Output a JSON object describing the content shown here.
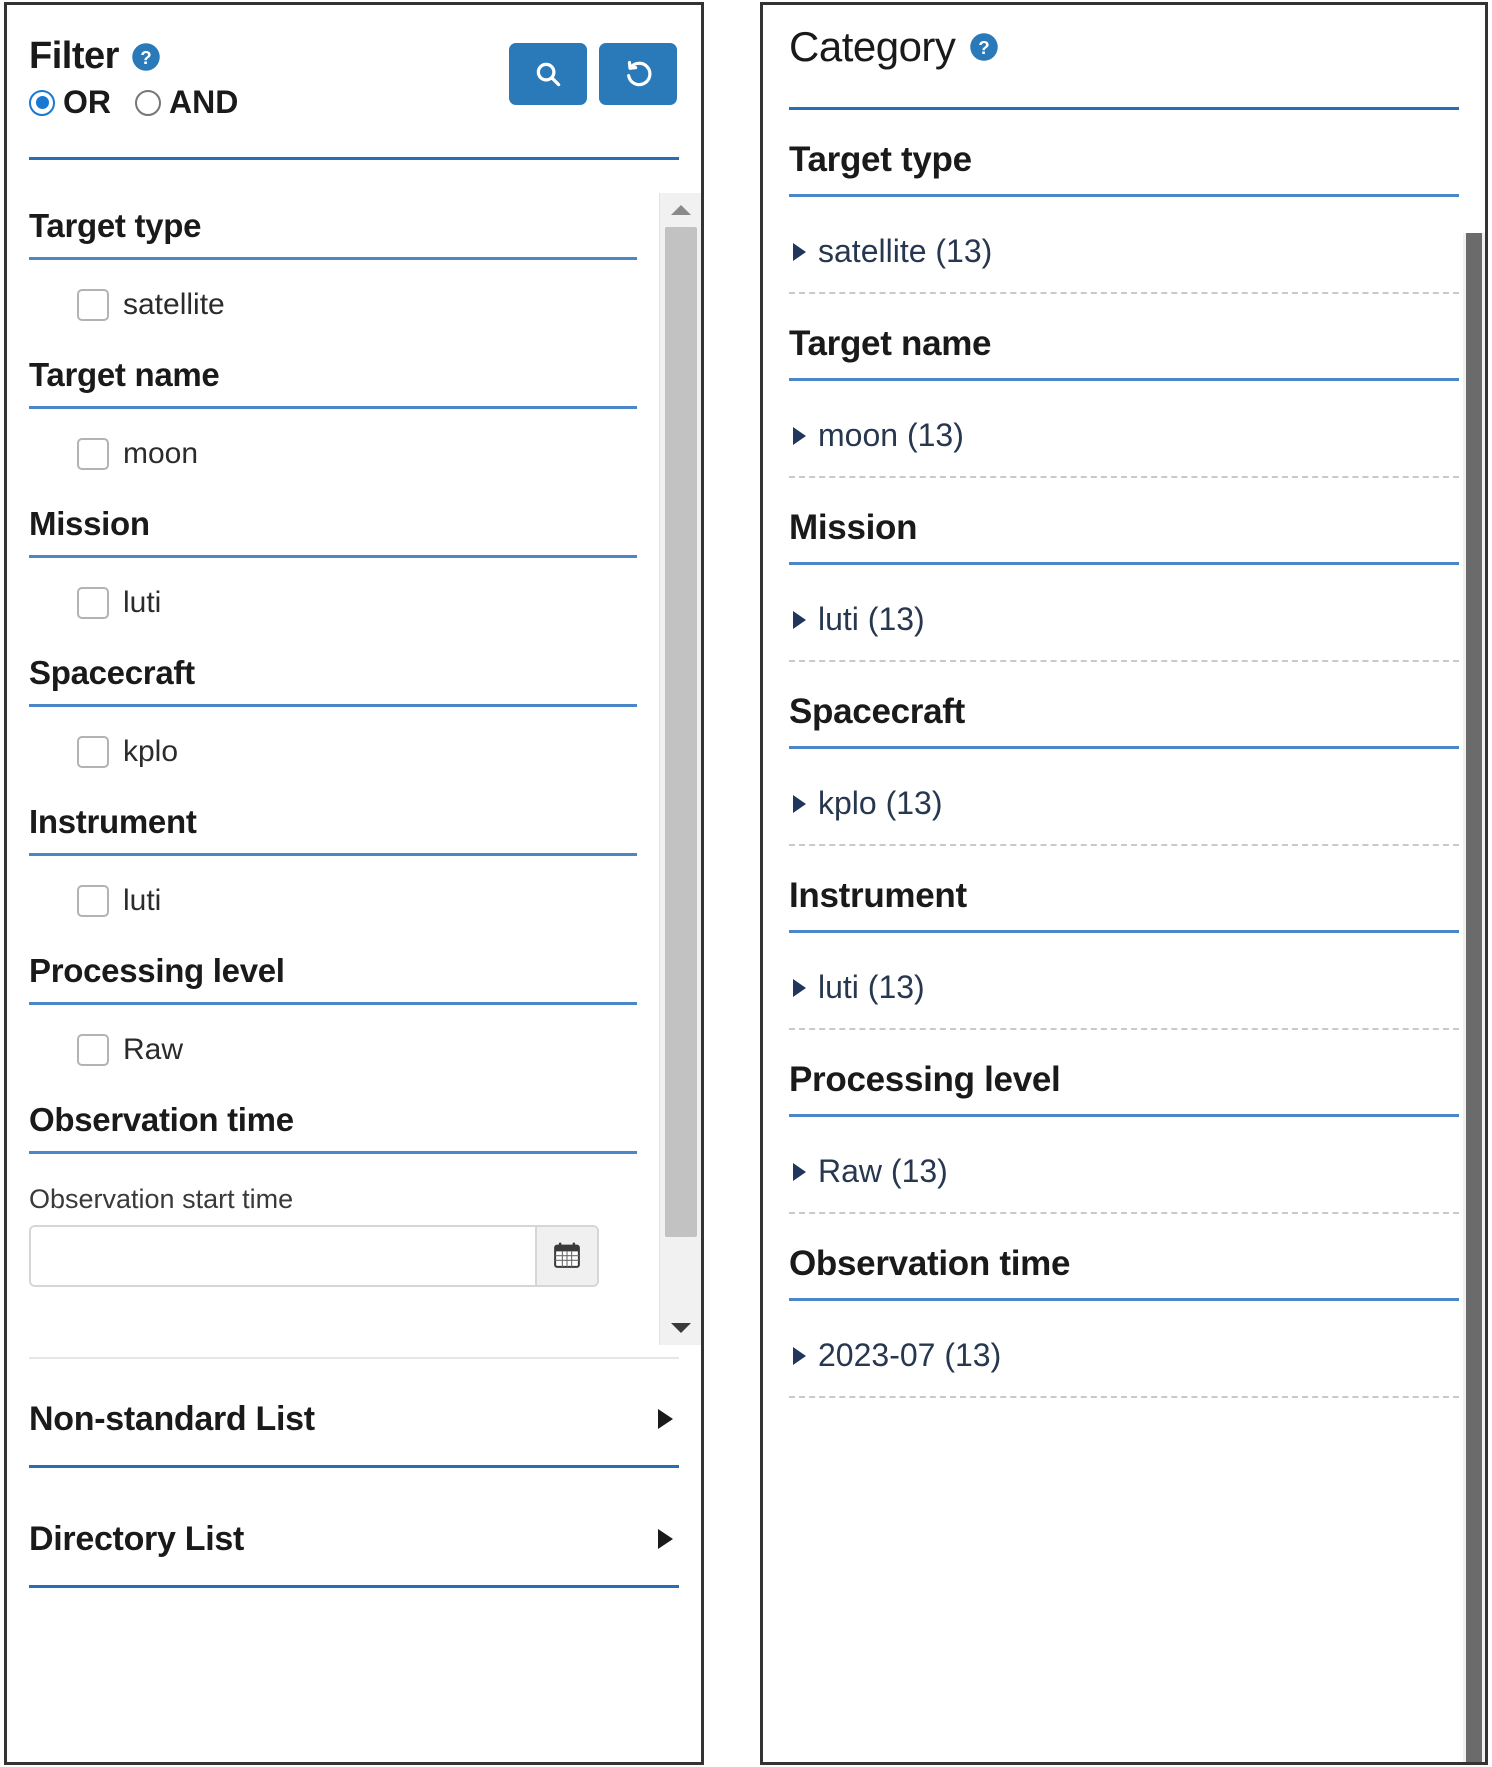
{
  "filter": {
    "title": "Filter",
    "help_icon": "help-circle-icon",
    "logic": {
      "or_label": "OR",
      "and_label": "AND",
      "selected": "OR"
    },
    "buttons": {
      "search": {
        "icon": "search-icon",
        "label": ""
      },
      "reset": {
        "icon": "reset-icon",
        "label": ""
      }
    },
    "groups": [
      {
        "title": "Target type",
        "option": "satellite",
        "checked": false
      },
      {
        "title": "Target name",
        "option": "moon",
        "checked": false
      },
      {
        "title": "Mission",
        "option": "luti",
        "checked": false
      },
      {
        "title": "Spacecraft",
        "option": "kplo",
        "checked": false
      },
      {
        "title": "Instrument",
        "option": "luti",
        "checked": false
      },
      {
        "title": "Processing level",
        "option": "Raw",
        "checked": false
      }
    ],
    "observation_time": {
      "group_title": "Observation time",
      "start_label": "Observation start time",
      "start_value": "",
      "start_placeholder": "",
      "calendar_icon": "calendar-icon"
    },
    "collapsibles": [
      {
        "title": "Non-standard List",
        "expand_icon": "triangle-right-icon"
      },
      {
        "title": "Directory List",
        "expand_icon": "triangle-right-icon"
      }
    ]
  },
  "category": {
    "title": "Category",
    "help_icon": "help-circle-icon",
    "groups": [
      {
        "title": "Target type",
        "items": [
          {
            "label": "satellite (13)",
            "expand_icon": "triangle-right-icon"
          }
        ]
      },
      {
        "title": "Target name",
        "items": [
          {
            "label": "moon (13)",
            "expand_icon": "triangle-right-icon"
          }
        ]
      },
      {
        "title": "Mission",
        "items": [
          {
            "label": "luti (13)",
            "expand_icon": "triangle-right-icon"
          }
        ]
      },
      {
        "title": "Spacecraft",
        "items": [
          {
            "label": "kplo (13)",
            "expand_icon": "triangle-right-icon"
          }
        ]
      },
      {
        "title": "Instrument",
        "items": [
          {
            "label": "luti (13)",
            "expand_icon": "triangle-right-icon"
          }
        ]
      },
      {
        "title": "Processing level",
        "items": [
          {
            "label": "Raw (13)",
            "expand_icon": "triangle-right-icon"
          }
        ]
      },
      {
        "title": "Observation time",
        "items": [
          {
            "label": "2023-07 (13)",
            "expand_icon": "triangle-right-icon"
          }
        ]
      }
    ]
  },
  "colors": {
    "accent_blue": "#2a7ab9",
    "rule_blue": "#2a6db5",
    "group_rule_blue": "#4a86c8",
    "radio_blue": "#1878d2",
    "text_dark": "#1a1a1a",
    "item_text": "#27374f"
  }
}
